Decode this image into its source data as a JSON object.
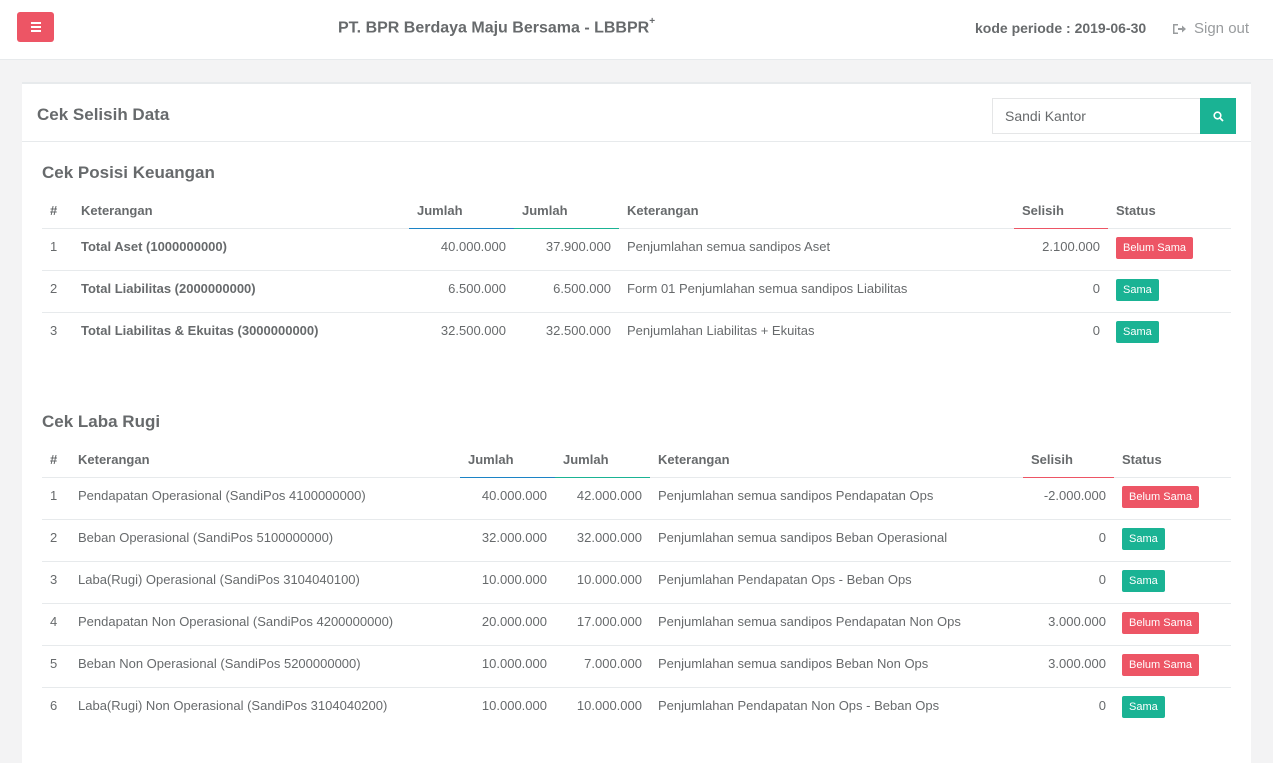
{
  "header": {
    "app_title": "PT. BPR Berdaya Maju Bersama - LBBPR",
    "app_title_sup": "+",
    "periode": "kode periode : 2019-06-30",
    "signout_label": "Sign out"
  },
  "panel": {
    "title": "Cek Selisih Data",
    "search_placeholder": "Sandi Kantor"
  },
  "posisi": {
    "title": "Cek Posisi Keuangan",
    "headers": [
      "#",
      "Keterangan",
      "Jumlah",
      "Jumlah",
      "Keterangan",
      "Selisih",
      "Status"
    ],
    "rows": [
      {
        "no": "1",
        "keterangan": "Total Aset (1000000000)",
        "jumlah1": "40.000.000",
        "jumlah2": "37.900.000",
        "ket2": "Penjumlahan semua sandipos Aset",
        "selisih": "2.100.000",
        "status": "Belum Sama"
      },
      {
        "no": "2",
        "keterangan": "Total Liabilitas (2000000000)",
        "jumlah1": "6.500.000",
        "jumlah2": "6.500.000",
        "ket2": "Form 01 Penjumlahan semua sandipos Liabilitas",
        "selisih": "0",
        "status": "Sama"
      },
      {
        "no": "3",
        "keterangan": "Total Liabilitas & Ekuitas (3000000000)",
        "jumlah1": "32.500.000",
        "jumlah2": "32.500.000",
        "ket2": "Penjumlahan Liabilitas + Ekuitas",
        "selisih": "0",
        "status": "Sama"
      }
    ]
  },
  "laba": {
    "title": "Cek Laba Rugi",
    "headers": [
      "#",
      "Keterangan",
      "Jumlah",
      "Jumlah",
      "Keterangan",
      "Selisih",
      "Status"
    ],
    "rows": [
      {
        "no": "1",
        "keterangan": "Pendapatan Operasional (SandiPos 4100000000)",
        "jumlah1": "40.000.000",
        "jumlah2": "42.000.000",
        "ket2": "Penjumlahan semua sandipos Pendapatan Ops",
        "selisih": "-2.000.000",
        "status": "Belum Sama"
      },
      {
        "no": "2",
        "keterangan": "Beban Operasional (SandiPos 5100000000)",
        "jumlah1": "32.000.000",
        "jumlah2": "32.000.000",
        "ket2": "Penjumlahan semua sandipos Beban Operasional",
        "selisih": "0",
        "status": "Sama"
      },
      {
        "no": "3",
        "keterangan": "Laba(Rugi) Operasional (SandiPos 3104040100)",
        "jumlah1": "10.000.000",
        "jumlah2": "10.000.000",
        "ket2": "Penjumlahan Pendapatan Ops - Beban Ops",
        "selisih": "0",
        "status": "Sama"
      },
      {
        "no": "4",
        "keterangan": "Pendapatan Non Operasional (SandiPos 4200000000)",
        "jumlah1": "20.000.000",
        "jumlah2": "17.000.000",
        "ket2": "Penjumlahan semua sandipos Pendapatan Non Ops",
        "selisih": "3.000.000",
        "status": "Belum Sama"
      },
      {
        "no": "5",
        "keterangan": "Beban Non Operasional (SandiPos 5200000000)",
        "jumlah1": "10.000.000",
        "jumlah2": "7.000.000",
        "ket2": "Penjumlahan semua sandipos Beban Non Ops",
        "selisih": "3.000.000",
        "status": "Belum Sama"
      },
      {
        "no": "6",
        "keterangan": "Laba(Rugi) Non Operasional (SandiPos 3104040200)",
        "jumlah1": "10.000.000",
        "jumlah2": "10.000.000",
        "ket2": "Penjumlahan Pendapatan Non Ops - Beban Ops",
        "selisih": "0",
        "status": "Sama"
      }
    ]
  },
  "colors": {
    "danger": "#ed5565",
    "primary": "#1ab394",
    "info": "#1c84c6"
  }
}
